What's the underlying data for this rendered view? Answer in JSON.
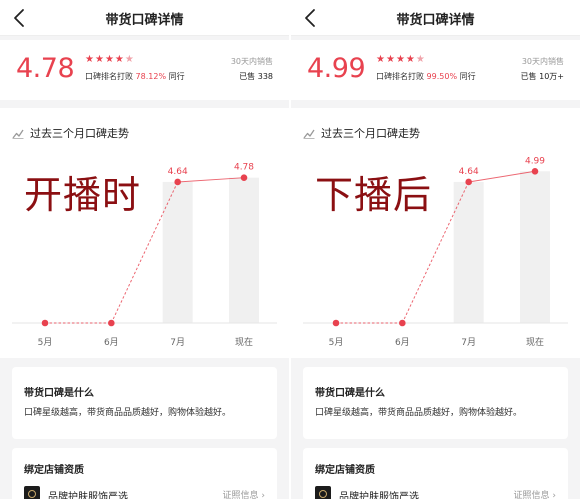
{
  "panels": [
    {
      "title": "带货口碑详情",
      "score": "4.78",
      "stars_filled": 4.5,
      "beat_prefix": "口碑排名打败",
      "beat_percent": "78.12%",
      "beat_suffix": "同行",
      "sales_label": "30天内销售",
      "sales_value": "已售 338",
      "trend_title": "过去三个月口碑走势",
      "overlay_text": "开播时",
      "info_title": "带货口碑是什么",
      "info_text": "口碑星级越高，带货商品品质越好，购物体验越好。",
      "store_title": "绑定店铺资质",
      "store_name": "品牌护肤服饰严选",
      "store_link": "证照信息 ›",
      "chart_data": {
        "type": "line",
        "categories": [
          "5月",
          "6月",
          "7月",
          "现在"
        ],
        "values": [
          0,
          0,
          4.64,
          4.78
        ],
        "labels": [
          "",
          "",
          "4.64",
          "4.78"
        ],
        "bars": [
          0,
          0,
          1,
          1
        ],
        "line_style": [
          "dashed",
          "dashed",
          "solid"
        ],
        "color": "#e8424f"
      }
    },
    {
      "title": "带货口碑详情",
      "score": "4.99",
      "stars_filled": 4.5,
      "beat_prefix": "口碑排名打败",
      "beat_percent": "99.50%",
      "beat_suffix": "同行",
      "sales_label": "30天内销售",
      "sales_value": "已售 10万+",
      "trend_title": "过去三个月口碑走势",
      "overlay_text": "下播后",
      "info_title": "带货口碑是什么",
      "info_text": "口碑星级越高，带货商品品质越好，购物体验越好。",
      "store_title": "绑定店铺资质",
      "store_name": "品牌护肤服饰严选",
      "store_link": "证照信息 ›",
      "chart_data": {
        "type": "line",
        "categories": [
          "5月",
          "6月",
          "7月",
          "现在"
        ],
        "values": [
          0,
          0,
          4.64,
          4.99
        ],
        "labels": [
          "",
          "",
          "4.64",
          "4.99"
        ],
        "bars": [
          0,
          0,
          1,
          1
        ],
        "line_style": [
          "dashed",
          "dashed",
          "solid"
        ],
        "color": "#e8424f"
      }
    }
  ],
  "colors": {
    "accent": "#e8424f",
    "overlay": "#8b0f12",
    "bar": "#f0f0f0"
  },
  "icons": {
    "back": "chevron-left-icon",
    "trend": "trend-chart-icon",
    "star": "star-icon"
  }
}
